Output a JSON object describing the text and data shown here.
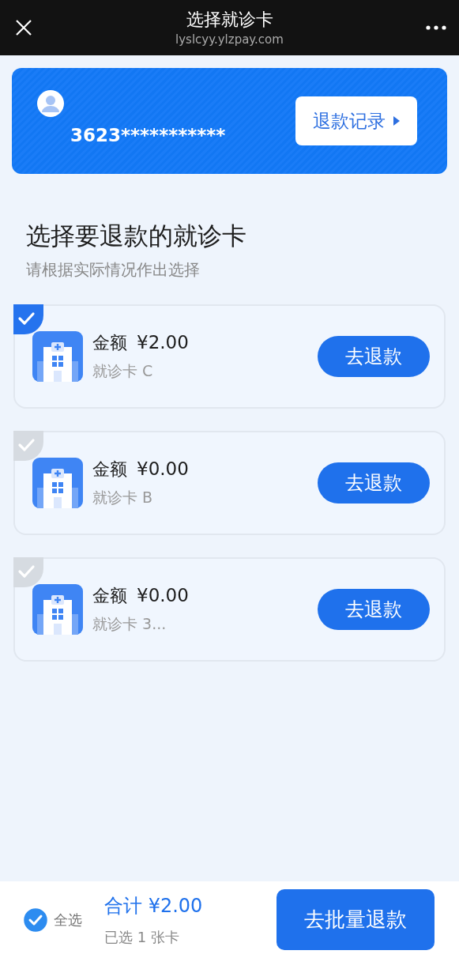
{
  "top_bar": {
    "title": "选择就诊卡",
    "url": "lyslcyy.ylzpay.com"
  },
  "account": {
    "id_number": "3623***********",
    "records_button": "退款记录"
  },
  "heading": {
    "title": "选择要退款的就诊卡",
    "subtitle": "请根据实际情况作出选择"
  },
  "cards": [
    {
      "amount_label": "金额",
      "amount": "¥2.00",
      "card_number": "就诊卡 C",
      "button": "去退款",
      "selected": true
    },
    {
      "amount_label": "金额",
      "amount": "¥0.00",
      "card_number": "就诊卡 B",
      "button": "去退款",
      "selected": false
    },
    {
      "amount_label": "金额",
      "amount": "¥0.00",
      "card_number": "就诊卡 3...",
      "button": "去退款",
      "selected": false
    }
  ],
  "footer": {
    "select_all": {
      "label": "全选",
      "checked": true
    },
    "total": "合计 ¥2.00",
    "count": "已选 1 张卡",
    "button": "去批量退款"
  }
}
